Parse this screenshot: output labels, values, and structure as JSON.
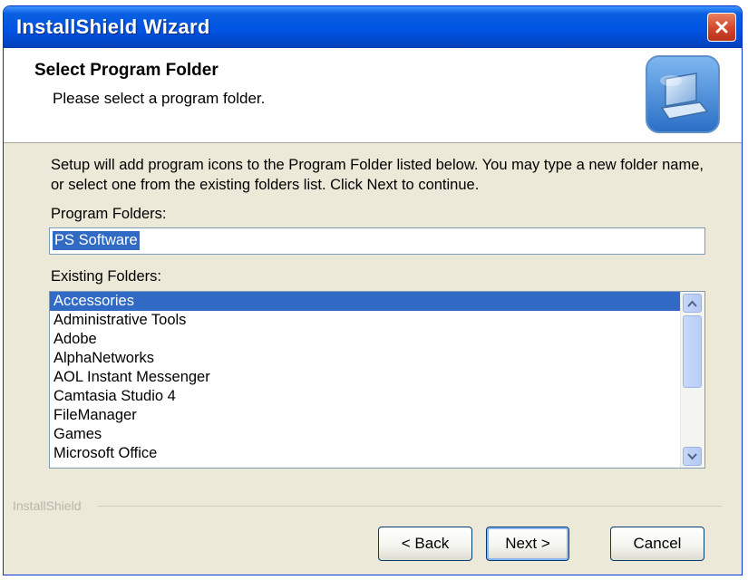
{
  "window": {
    "title": "InstallShield Wizard"
  },
  "header": {
    "title": "Select Program Folder",
    "subtitle": "Please select a program folder."
  },
  "body": {
    "instructions": "Setup will add program icons to the Program Folder listed below. You may type a new folder name, or select one from the existing folders list. Click Next to continue.",
    "program_folders_label": "Program Folders:",
    "program_folder_value": "PS Software",
    "existing_folders_label": "Existing Folders:",
    "existing_folders": [
      "Accessories",
      "Administrative Tools",
      "Adobe",
      "AlphaNetworks",
      "AOL Instant Messenger",
      "Camtasia Studio 4",
      "FileManager",
      "Games",
      "Microsoft Office"
    ],
    "selected_index": 0
  },
  "footer": {
    "brand": "InstallShield",
    "back_label": "< Back",
    "next_label": "Next >",
    "cancel_label": "Cancel"
  },
  "colors": {
    "selection": "#316ac5",
    "titlebar": "#0054e3",
    "dialog_bg": "#ece9d8"
  },
  "icons": {
    "close": "close-icon",
    "header": "computer-install-icon",
    "scroll_up": "chevron-up-icon",
    "scroll_down": "chevron-down-icon"
  }
}
